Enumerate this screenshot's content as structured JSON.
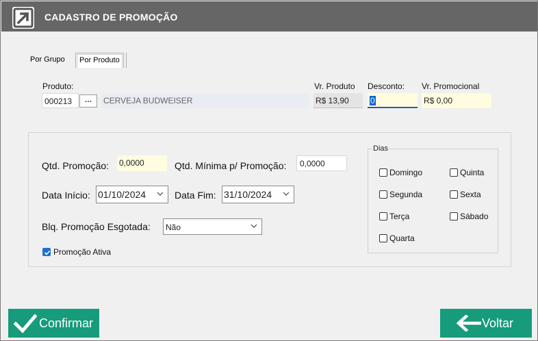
{
  "window": {
    "title": "CADASTRO DE PROMOÇÃO",
    "logo_icon": "arrow-up-right-icon"
  },
  "tabs": [
    {
      "label": "Por Grupo"
    },
    {
      "label": "Por Produto"
    }
  ],
  "produto": {
    "label": "Produto:",
    "code": "000213",
    "lookup_button": "…",
    "description": "CERVEJA BUDWEISER"
  },
  "vr_produto": {
    "label": "Vr. Produto",
    "value": "R$ 13,90"
  },
  "desconto": {
    "label": "Desconto:",
    "value": "0"
  },
  "vr_promocional": {
    "label": "Vr. Promocional",
    "value": "R$ 0,00"
  },
  "qtd_promocao": {
    "label": "Qtd. Promoção:",
    "value": "0,0000"
  },
  "qtd_minima": {
    "label": "Qtd. Mínima p/ Promoção:",
    "value": "0,0000"
  },
  "data_inicio": {
    "label": "Data Início:",
    "value": "01/10/2024"
  },
  "data_fim": {
    "label": "Data Fim:",
    "value": "31/10/2024"
  },
  "blq_promocao": {
    "label": "Blq. Promoção Esgotada:",
    "value": "Não"
  },
  "promocao_ativa": {
    "label": "Promoção Ativa",
    "checked": true
  },
  "dias": {
    "label": "Dias",
    "items": [
      {
        "label": "Domingo",
        "checked": false
      },
      {
        "label": "Quinta",
        "checked": false
      },
      {
        "label": "Segunda",
        "checked": false
      },
      {
        "label": "Sexta",
        "checked": false
      },
      {
        "label": "Terça",
        "checked": false
      },
      {
        "label": "Sábado",
        "checked": false
      },
      {
        "label": "Quarta",
        "checked": false
      }
    ]
  },
  "buttons": {
    "confirm": "Confirmar",
    "back": "Voltar"
  },
  "colors": {
    "titlebar": "#666666",
    "action_button": "#169b7b",
    "highlight_field": "#fffce0",
    "checkbox_checked": "#1e6fd0"
  }
}
